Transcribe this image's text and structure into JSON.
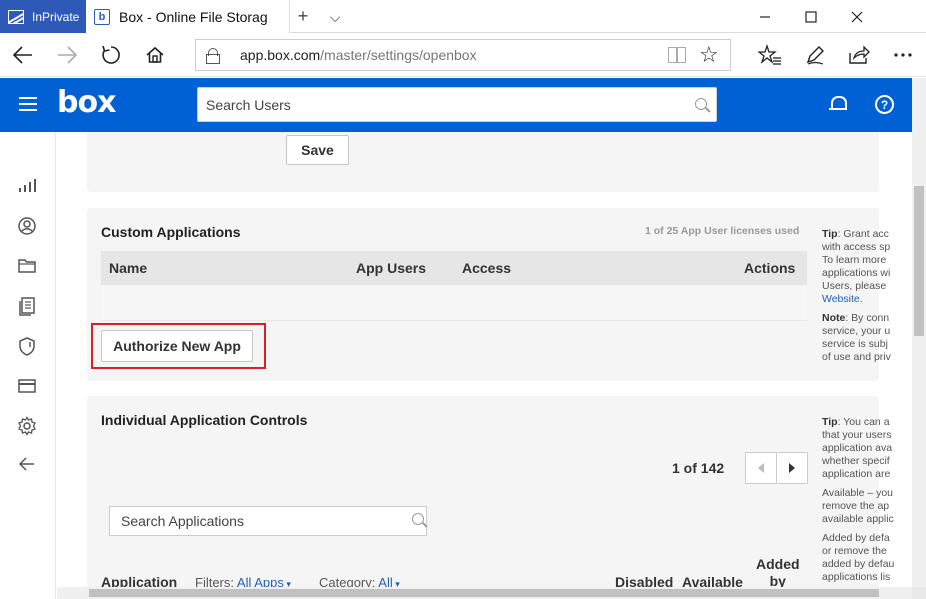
{
  "browser": {
    "inprivate_label": "InPrivate",
    "tab_title": "Box - Online File Storag",
    "tab_favicon": "b",
    "new_tab_symbol": "+",
    "tab_list_symbol": "⌵",
    "url_domain": "app.box.com",
    "url_path": "/master/settings/openbox"
  },
  "header": {
    "logo": "box",
    "search_placeholder": "Search Users",
    "help_symbol": "?"
  },
  "top_panel": {
    "save_label": "Save"
  },
  "custom_apps": {
    "title": "Custom Applications",
    "license_text": "1 of 25 App User licenses used",
    "columns": {
      "name": "Name",
      "app_users": "App Users",
      "access": "Access",
      "actions": "Actions"
    },
    "authorize_label": "Authorize New App",
    "tip": {
      "tip_label": "Tip",
      "tip_lines": [
        ": Grant acc",
        "with access sp",
        "To learn more",
        "applications wi",
        "Users, please"
      ],
      "tip_link": "Website",
      "note_label": "Note",
      "note_lines": [
        ": By conn",
        "service, your u",
        "service is subj",
        "of use and priv"
      ]
    }
  },
  "individual_apps": {
    "title": "Individual Application Controls",
    "pager_text": "1 of 142",
    "search_placeholder": "Search Applications",
    "footer": {
      "application": "Application",
      "filters_label": "Filters:",
      "filters_value": "All Apps",
      "category_label": "Category:",
      "category_value": "All",
      "disabled": "Disabled",
      "available": "Available",
      "added_by_line1": "Added",
      "added_by_line2": "by"
    },
    "tip": {
      "tip_label": "Tip",
      "tip_lines": [
        ": You can a",
        "that your users",
        "application ava",
        "whether specif",
        "application are"
      ],
      "para2": [
        "Available – you",
        "remove the ap",
        "available applic"
      ],
      "para3": [
        "Added by defa",
        "or remove the",
        "added by defau",
        "applications lis"
      ]
    }
  },
  "colors": {
    "box_blue": "#0061d5",
    "inprivate_blue": "#2e59b6",
    "highlight_red": "#d92027",
    "link_blue": "#1e61b9"
  }
}
